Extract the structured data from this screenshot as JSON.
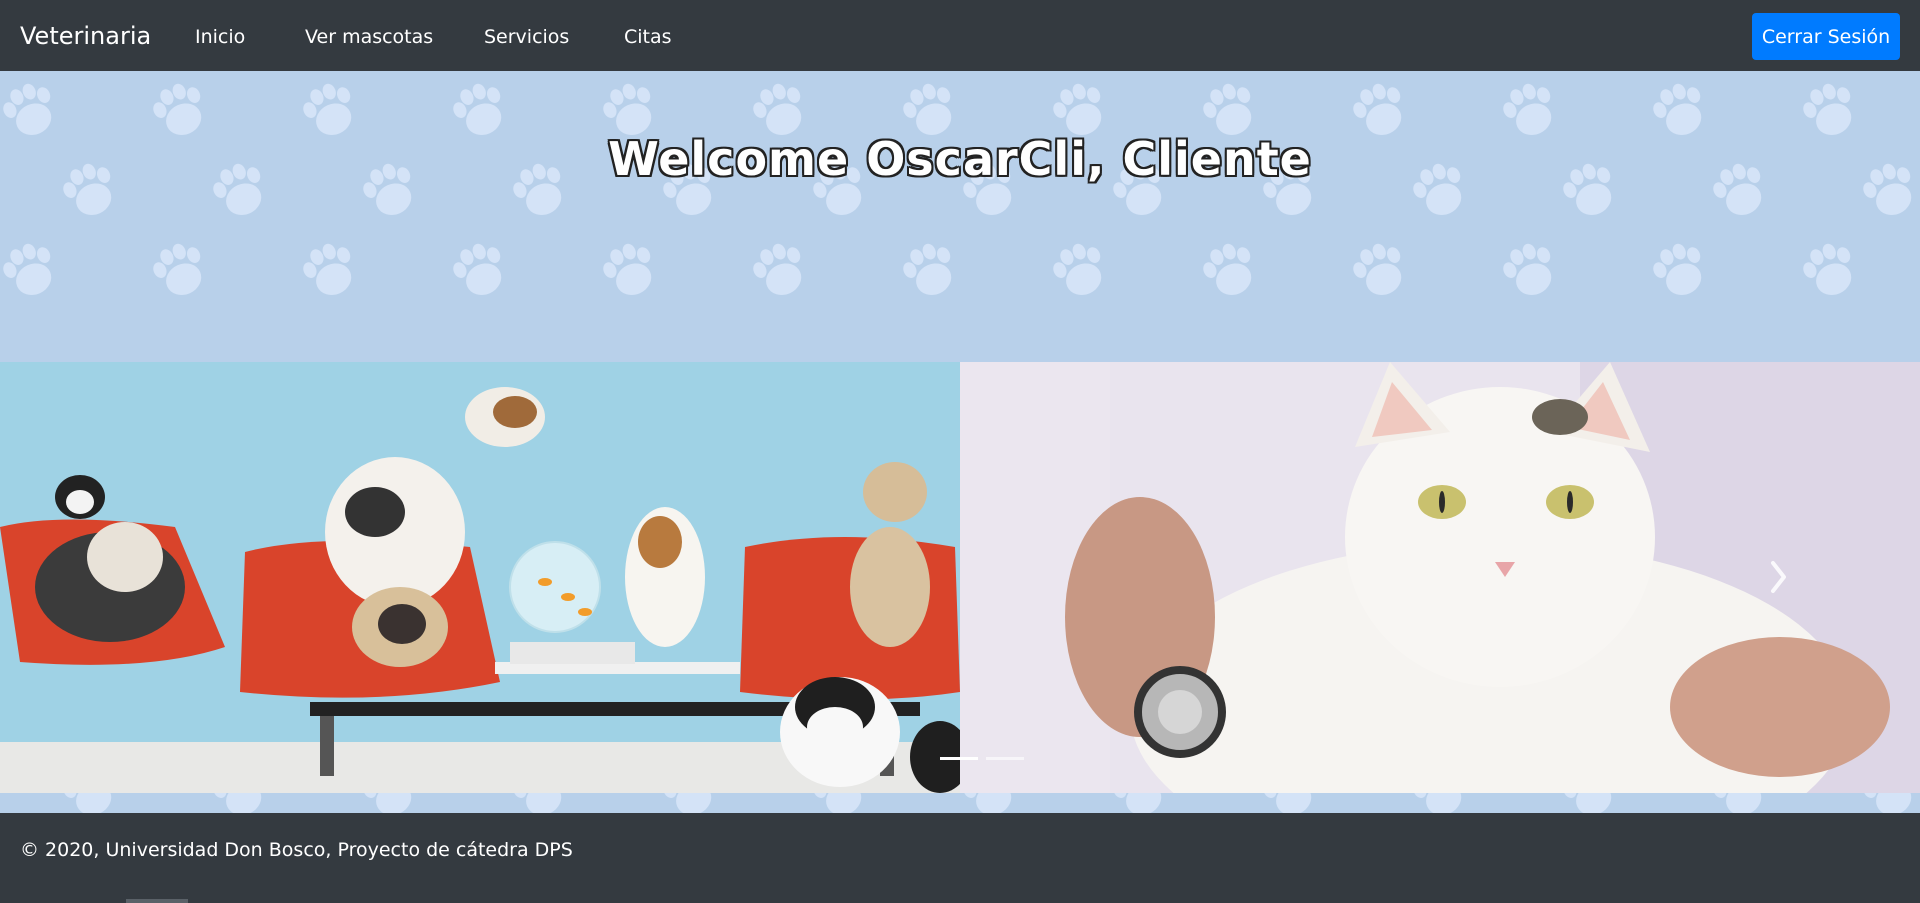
{
  "navbar": {
    "brand": "Veterinaria",
    "links": [
      "Inicio",
      "Ver mascotas",
      "Servicios",
      "Citas"
    ],
    "logout_label": "Cerrar Sesión"
  },
  "hero": {
    "welcome_text": "Welcome OscarCli, Cliente"
  },
  "carousel": {
    "slides": [
      {
        "image": "pets-waiting-room-photo"
      },
      {
        "image": "vet-examining-white-cat-photo"
      }
    ],
    "active_index": 0,
    "next_icon": "chevron-right-icon"
  },
  "footer": {
    "text": "© 2020, Universidad Don Bosco, Proyecto de cátedra DPS"
  },
  "colors": {
    "navbar_bg": "#343a40",
    "primary": "#007bff",
    "page_bg": "#b8d0ea",
    "paw": "#d4e3f7"
  }
}
